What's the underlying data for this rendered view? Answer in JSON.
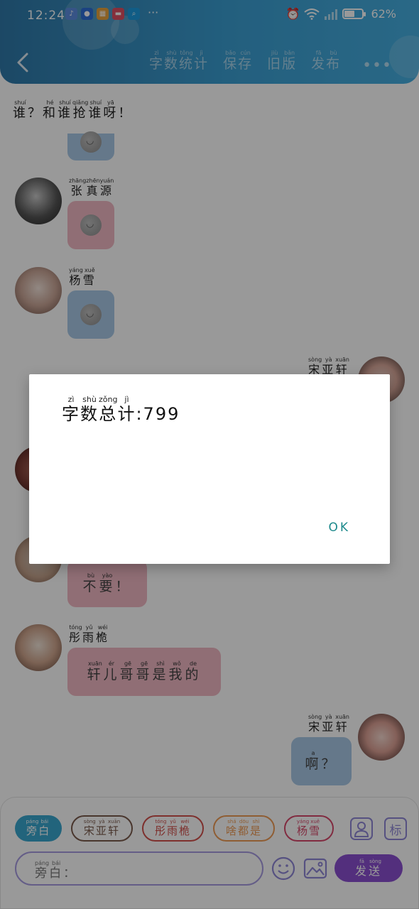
{
  "status_bar": {
    "time": "12:24",
    "more": "···",
    "battery_percent": "62%",
    "battery_level": 0.62
  },
  "header": {
    "back_icon": "chevron-left-icon",
    "actions": [
      {
        "id": "word-count",
        "chars": [
          [
            "字",
            "zì"
          ],
          [
            "数",
            "shù"
          ],
          [
            "统",
            "tǒng"
          ],
          [
            "计",
            "jì"
          ]
        ]
      },
      {
        "id": "save",
        "chars": [
          [
            "保",
            "bǎo"
          ],
          [
            "存",
            "cún"
          ]
        ]
      },
      {
        "id": "old-version",
        "chars": [
          [
            "旧",
            "jiù"
          ],
          [
            "版",
            "bǎn"
          ]
        ]
      },
      {
        "id": "publish",
        "chars": [
          [
            "发",
            "fā"
          ],
          [
            "布",
            "bù"
          ]
        ]
      }
    ],
    "more_label": "•••"
  },
  "chat": {
    "top_message": {
      "chars": [
        [
          "谁",
          "shuí"
        ],
        [
          "？",
          ""
        ],
        [
          "和",
          "hé"
        ],
        [
          "谁",
          "shuí"
        ],
        [
          "抢",
          "qiǎng"
        ],
        [
          "谁",
          "shuí"
        ],
        [
          "呀",
          "yā"
        ],
        [
          "！",
          ""
        ]
      ]
    },
    "messages": [
      {
        "id": "zhang",
        "side": "left",
        "name": [
          [
            "张",
            "zhāng"
          ],
          [
            "真",
            "zhēn"
          ],
          [
            "源",
            "yuán"
          ]
        ],
        "bubble_color": "#f0b8c3",
        "type": "emoji"
      },
      {
        "id": "yang",
        "side": "left",
        "name": [
          [
            "杨",
            "yáng"
          ],
          [
            "雪",
            "xuě"
          ]
        ],
        "bubble_color": "#a8c8e6",
        "type": "emoji"
      },
      {
        "id": "song1",
        "side": "right",
        "name": [
          [
            "宋",
            "sòng"
          ],
          [
            "亚",
            "yà"
          ],
          [
            "轩",
            "xuān"
          ]
        ]
      },
      {
        "id": "buyao",
        "side": "left",
        "bubble_color": "#f0b8c3",
        "text": [
          [
            "不",
            "bù"
          ],
          [
            "要",
            "yào"
          ],
          [
            "！",
            ""
          ]
        ]
      },
      {
        "id": "tong",
        "side": "left",
        "name": [
          [
            "彤",
            "tóng"
          ],
          [
            "雨",
            "yǔ"
          ],
          [
            "桅",
            "wéi"
          ]
        ],
        "bubble_color": "#f0b8c3",
        "text": [
          [
            "轩",
            "xuān"
          ],
          [
            "儿",
            "ér"
          ],
          [
            "哥",
            "gē"
          ],
          [
            "哥",
            "gē"
          ],
          [
            "是",
            "shì"
          ],
          [
            "我",
            "wǒ"
          ],
          [
            "的",
            "de"
          ]
        ]
      },
      {
        "id": "song2",
        "side": "right",
        "name": [
          [
            "宋",
            "sòng"
          ],
          [
            "亚",
            "yà"
          ],
          [
            "轩",
            "xuān"
          ]
        ],
        "bubble_color": "#a8c8e6",
        "text": [
          [
            "啊",
            "a"
          ],
          [
            "？",
            ""
          ]
        ]
      }
    ]
  },
  "dialog": {
    "title_chars": [
      [
        "字",
        "zì"
      ],
      [
        "数",
        "shù"
      ],
      [
        "总",
        "zǒng"
      ],
      [
        "计",
        "jì"
      ]
    ],
    "count_text": ":799",
    "ok_label": "OK"
  },
  "bottom": {
    "roles": [
      {
        "id": "narration",
        "chars": [
          [
            "旁",
            "páng"
          ],
          [
            "白",
            "bái"
          ]
        ],
        "color": "#3aa7cf",
        "filled": true
      },
      {
        "id": "song",
        "chars": [
          [
            "宋",
            "sòng"
          ],
          [
            "亚",
            "yà"
          ],
          [
            "轩",
            "xuān"
          ]
        ],
        "color": "#7a5a4c",
        "filled": false
      },
      {
        "id": "tong",
        "chars": [
          [
            "彤",
            "tóng"
          ],
          [
            "雨",
            "yǔ"
          ],
          [
            "桅",
            "wéi"
          ]
        ],
        "color": "#d2504c",
        "filled": false
      },
      {
        "id": "shadoushi",
        "chars": [
          [
            "啥",
            "shá"
          ],
          [
            "都",
            "dōu"
          ],
          [
            "是",
            "shì"
          ]
        ],
        "color": "#ef9b55",
        "filled": false
      },
      {
        "id": "yangxue",
        "chars": [
          [
            "杨",
            "yáng"
          ],
          [
            "雪",
            "xuě"
          ]
        ],
        "color": "#d8496c",
        "filled": false
      }
    ],
    "person_icon": "person-icon",
    "mark_label": "标",
    "input_placeholder": [
      [
        "旁",
        "páng"
      ],
      [
        "白",
        "bái"
      ],
      [
        "：",
        ""
      ]
    ],
    "emoji_icon": "smiley-icon",
    "image_icon": "image-icon",
    "send_chars": [
      [
        "发",
        "fā"
      ],
      [
        "送",
        "sòng"
      ]
    ]
  }
}
